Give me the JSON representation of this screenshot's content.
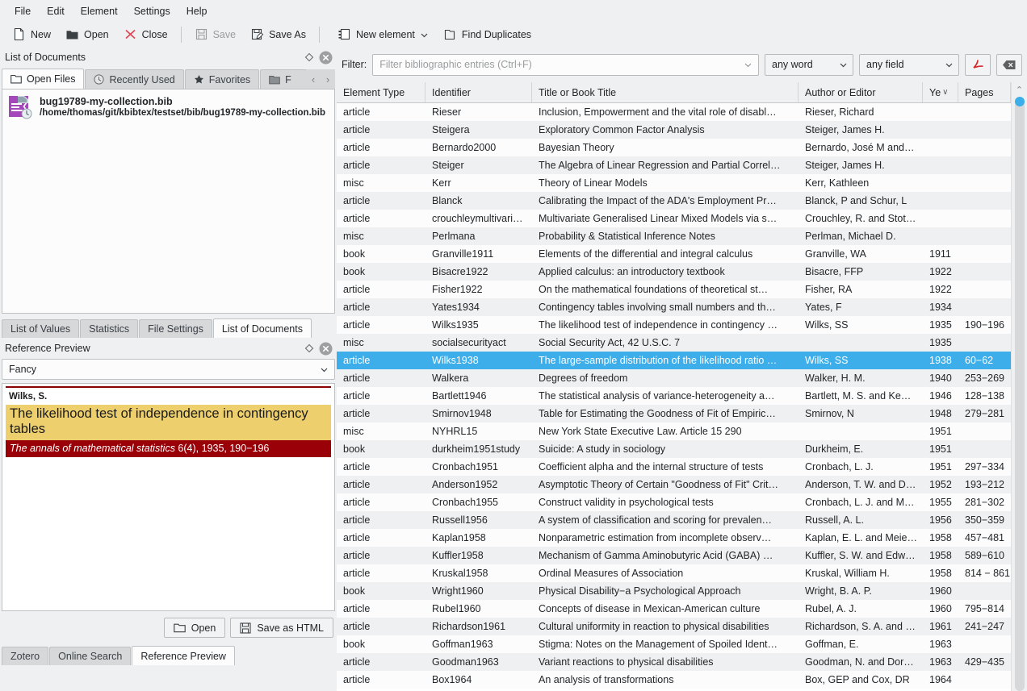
{
  "menubar": [
    "File",
    "Edit",
    "Element",
    "Settings",
    "Help"
  ],
  "toolbar": {
    "left": [
      {
        "label": "New",
        "icon": "new-document-icon",
        "disabled": false
      },
      {
        "label": "Open",
        "icon": "folder-open-icon",
        "disabled": false
      },
      {
        "label": "Close",
        "icon": "close-x-icon",
        "disabled": false
      },
      {
        "label": "Save",
        "icon": "save-floppy-icon",
        "disabled": true
      },
      {
        "label": "Save As",
        "icon": "save-as-floppy-icon",
        "disabled": false
      }
    ],
    "right": [
      {
        "label": "New element",
        "icon": "new-element-icon",
        "has_dropdown": true
      },
      {
        "label": "Find Duplicates",
        "icon": "find-duplicates-icon",
        "has_dropdown": false
      }
    ]
  },
  "left_dock": {
    "title": "List of Documents",
    "float_icon": "float-diamond-icon",
    "close_icon": "close-circle-icon",
    "tabs": [
      {
        "label": "Open Files",
        "icon": "folder-icon",
        "active": true
      },
      {
        "label": "Recently Used",
        "icon": "clock-icon",
        "active": false
      },
      {
        "label": "Favorites",
        "icon": "star-icon",
        "active": false
      },
      {
        "label": "F",
        "icon": "folder-icon",
        "active": false
      }
    ],
    "tab_scroll_left": "‹",
    "tab_scroll_right": "›",
    "files": [
      {
        "icon": "bibtex-file-icon",
        "name": "bug19789-my-collection.bib",
        "path": "/home/thomas/git/kbibtex/testset/bib/bug19789-my-collection.bib"
      }
    ],
    "bottom_tabs": [
      {
        "label": "List of Values",
        "active": false
      },
      {
        "label": "Statistics",
        "active": false
      },
      {
        "label": "File Settings",
        "active": false
      },
      {
        "label": "List of Documents",
        "active": true
      }
    ]
  },
  "preview_dock": {
    "title": "Reference Preview",
    "float_icon": "float-diamond-icon",
    "close_icon": "close-circle-icon",
    "style_select": {
      "value": "Fancy",
      "chevron": "chevron-down-icon"
    },
    "reference": {
      "author": "Wilks, S.",
      "title": "The likelihood test of independence in contingency tables",
      "journal": "The annals of mathematical statistics",
      "details": " 6(4), 1935, 190−196"
    },
    "buttons": [
      {
        "label": "Open",
        "icon": "folder-open-icon"
      },
      {
        "label": "Save as HTML",
        "icon": "save-floppy-icon"
      }
    ],
    "bottom_tabs": [
      {
        "label": "Zotero",
        "active": false
      },
      {
        "label": "Online Search",
        "active": false
      },
      {
        "label": "Reference Preview",
        "active": true
      }
    ]
  },
  "filter": {
    "label": "Filter:",
    "placeholder": "Filter bibliographic entries (Ctrl+F)",
    "value": "",
    "dropdown_icon": "chevron-down-icon",
    "word_mode": {
      "value": "any word",
      "chevron": "chevron-down-icon"
    },
    "field_mode": {
      "value": "any field",
      "chevron": "chevron-down-icon"
    },
    "pdf_button": {
      "icon": "acrobat-pdf-icon"
    },
    "clear_button": {
      "icon": "clear-backspace-icon"
    }
  },
  "scrollbar": {
    "up_arrow": "⌃",
    "handle_color": "#3daee9"
  },
  "colors": {
    "selection": "#3daee9",
    "preview_title_bg": "#edcf6e",
    "preview_journal_bg": "#9a0007",
    "window_bg": "#eff0f1"
  },
  "table": {
    "columns": [
      {
        "label": "Element Type",
        "key": "c0",
        "sorted": false
      },
      {
        "label": "Identifier",
        "key": "c1",
        "sorted": false
      },
      {
        "label": "Title or Book Title",
        "key": "c2",
        "sorted": false
      },
      {
        "label": "Author or Editor",
        "key": "c3",
        "sorted": false
      },
      {
        "label": "Ye",
        "key": "c4",
        "sorted": true,
        "sort_indicator": "∨"
      },
      {
        "label": "Pages",
        "key": "c5",
        "sorted": false
      }
    ],
    "selected_index": 14,
    "rows": [
      {
        "type": "article",
        "id": "Rieser",
        "title": "Inclusion, Empowerment and the vital role of disabl…",
        "author": "Rieser, Richard",
        "year": "",
        "pages": ""
      },
      {
        "type": "article",
        "id": "Steigera",
        "title": "Exploratory Common Factor Analysis",
        "author": "Steiger, James H.",
        "year": "",
        "pages": ""
      },
      {
        "type": "article",
        "id": "Bernardo2000",
        "title": "Bayesian Theory",
        "author": "Bernardo, José M and…",
        "year": "",
        "pages": ""
      },
      {
        "type": "article",
        "id": "Steiger",
        "title": "The Algebra of Linear Regression and Partial Correl…",
        "author": "Steiger, James H.",
        "year": "",
        "pages": ""
      },
      {
        "type": "misc",
        "id": "Kerr",
        "title": "Theory of Linear Models",
        "author": "Kerr, Kathleen",
        "year": "",
        "pages": ""
      },
      {
        "type": "article",
        "id": "Blanck",
        "title": "Calibrating the Impact of the ADA's Employment Pr…",
        "author": "Blanck, P and Schur, L",
        "year": "",
        "pages": ""
      },
      {
        "type": "article",
        "id": "crouchleymultivari…",
        "title": "Multivariate Generalised Linear Mixed Models via s…",
        "author": "Crouchley, R. and Stot…",
        "year": "",
        "pages": ""
      },
      {
        "type": "misc",
        "id": "Perlmana",
        "title": "Probability & Statistical Inference Notes",
        "author": "Perlman, Michael D.",
        "year": "",
        "pages": ""
      },
      {
        "type": "book",
        "id": "Granville1911",
        "title": "Elements of the differential and integral calculus",
        "author": "Granville, WA",
        "year": "1911",
        "pages": ""
      },
      {
        "type": "book",
        "id": "Bisacre1922",
        "title": "Applied calculus: an introductory textbook",
        "author": "Bisacre, FFP",
        "year": "1922",
        "pages": ""
      },
      {
        "type": "article",
        "id": "Fisher1922",
        "title": "On the mathematical foundations of theoretical st…",
        "author": "Fisher, RA",
        "year": "1922",
        "pages": ""
      },
      {
        "type": "article",
        "id": "Yates1934",
        "title": "Contingency tables involving small numbers and th…",
        "author": "Yates, F",
        "year": "1934",
        "pages": ""
      },
      {
        "type": "article",
        "id": "Wilks1935",
        "title": "The likelihood test of independence in contingency …",
        "author": "Wilks, SS",
        "year": "1935",
        "pages": "190−196"
      },
      {
        "type": "misc",
        "id": "socialsecurityact",
        "title": "Social Security Act, 42 U.S.C. 7",
        "author": "",
        "year": "1935",
        "pages": ""
      },
      {
        "type": "article",
        "id": "Wilks1938",
        "title": "The large-sample distribution of the likelihood ratio …",
        "author": "Wilks, SS",
        "year": "1938",
        "pages": "60−62"
      },
      {
        "type": "article",
        "id": "Walkera",
        "title": "Degrees of freedom",
        "author": "Walker, H. M.",
        "year": "1940",
        "pages": "253−269"
      },
      {
        "type": "article",
        "id": "Bartlett1946",
        "title": "The statistical analysis of variance-heterogeneity a…",
        "author": "Bartlett, M. S. and Ke…",
        "year": "1946",
        "pages": "128−138"
      },
      {
        "type": "article",
        "id": "Smirnov1948",
        "title": "Table for Estimating the Goodness of Fit of Empiric…",
        "author": "Smirnov, N",
        "year": "1948",
        "pages": "279−281"
      },
      {
        "type": "misc",
        "id": "NYHRL15",
        "title": "New York State Executive Law. Article 15 290",
        "author": "",
        "year": "1951",
        "pages": ""
      },
      {
        "type": "book",
        "id": "durkheim1951study",
        "title": "Suicide: A study in sociology",
        "author": "Durkheim, E.",
        "year": "1951",
        "pages": ""
      },
      {
        "type": "article",
        "id": "Cronbach1951",
        "title": "Coefficient alpha and the internal structure of tests",
        "author": "Cronbach, L. J.",
        "year": "1951",
        "pages": "297−334"
      },
      {
        "type": "article",
        "id": "Anderson1952",
        "title": "Asymptotic Theory of Certain \"Goodness of Fit\" Crit…",
        "author": "Anderson, T. W. and D…",
        "year": "1952",
        "pages": "193−212"
      },
      {
        "type": "article",
        "id": "Cronbach1955",
        "title": "Construct validity in psychological tests",
        "author": "Cronbach, L. J. and M…",
        "year": "1955",
        "pages": "281−302"
      },
      {
        "type": "article",
        "id": "Russell1956",
        "title": "A system of classification and scoring for prevalen…",
        "author": "Russell, A. L.",
        "year": "1956",
        "pages": "350−359"
      },
      {
        "type": "article",
        "id": "Kaplan1958",
        "title": "Nonparametric estimation from incomplete observ…",
        "author": "Kaplan, E. L. and Meie…",
        "year": "1958",
        "pages": "457−481"
      },
      {
        "type": "article",
        "id": "Kuffler1958",
        "title": "Mechanism of Gamma Aminobutyric Acid (GABA) …",
        "author": "Kuffler, S. W. and Edw…",
        "year": "1958",
        "pages": "589−610"
      },
      {
        "type": "article",
        "id": "Kruskal1958",
        "title": "Ordinal Measures of Association",
        "author": "Kruskal, William H.",
        "year": "1958",
        "pages": "814 − 861"
      },
      {
        "type": "book",
        "id": "Wright1960",
        "title": "Physical Disability−a Psychological Approach",
        "author": "Wright, B. A. P.",
        "year": "1960",
        "pages": ""
      },
      {
        "type": "article",
        "id": "Rubel1960",
        "title": "Concepts of disease in Mexican-American culture",
        "author": "Rubel, A. J.",
        "year": "1960",
        "pages": "795−814"
      },
      {
        "type": "article",
        "id": "Richardson1961",
        "title": "Cultural uniformity in reaction to physical disabilities",
        "author": "Richardson, S. A. and …",
        "year": "1961",
        "pages": "241−247"
      },
      {
        "type": "book",
        "id": "Goffman1963",
        "title": "Stigma: Notes on the Management of Spoiled Ident…",
        "author": "Goffman, E.",
        "year": "1963",
        "pages": ""
      },
      {
        "type": "article",
        "id": "Goodman1963",
        "title": "Variant reactions to physical disabilities",
        "author": "Goodman, N. and Dor…",
        "year": "1963",
        "pages": "429−435"
      },
      {
        "type": "article",
        "id": "Box1964",
        "title": "An analysis of transformations",
        "author": "Box, GEP and Cox, DR",
        "year": "1964",
        "pages": ""
      }
    ]
  }
}
